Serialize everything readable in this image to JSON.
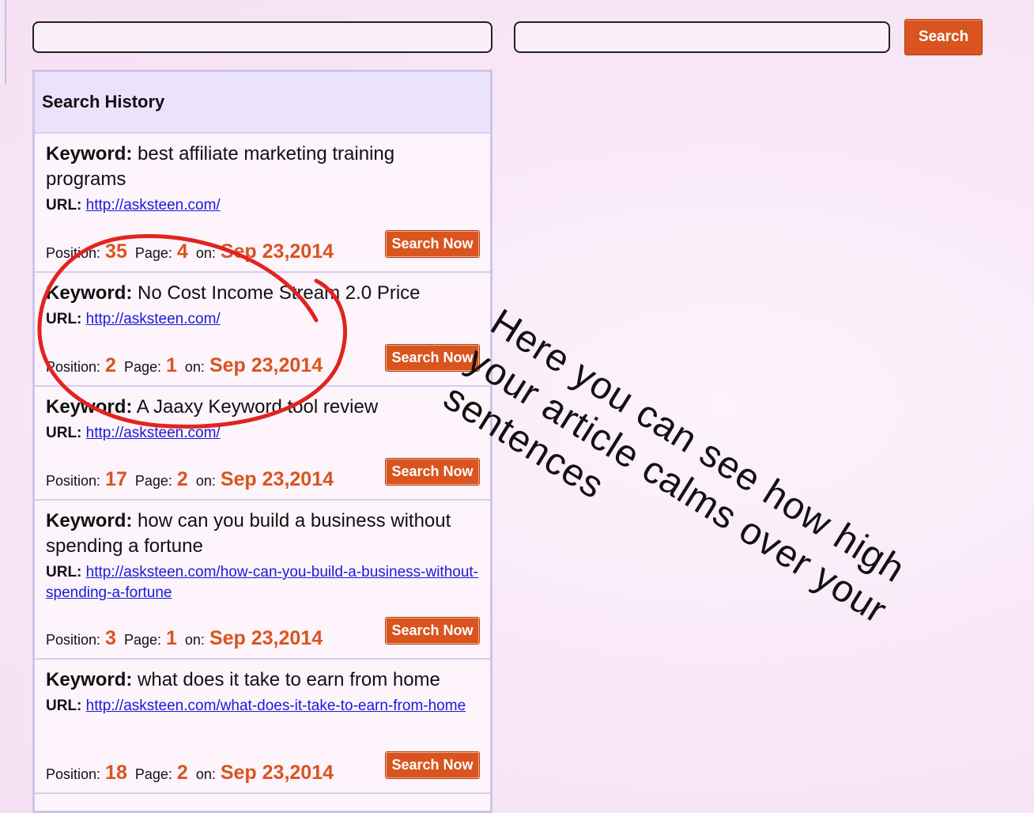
{
  "search": {
    "keyword_value": "",
    "url_value": "",
    "button_label": "Search"
  },
  "history": {
    "title": "Search History",
    "labels": {
      "keyword": "Keyword:",
      "url": "URL:",
      "position": "Position:",
      "page": "Page:",
      "on": "on:",
      "button": "Search Now"
    },
    "entries": [
      {
        "keyword": "best affiliate marketing training programs",
        "url": "http://asksteen.com/",
        "position": "35",
        "page": "4",
        "date": "Sep 23,2014"
      },
      {
        "keyword": "No Cost Income Stream 2.0 Price",
        "url": "http://asksteen.com/",
        "position": "2",
        "page": "1",
        "date": "Sep 23,2014"
      },
      {
        "keyword": "A Jaaxy Keyword tool review",
        "url": "http://asksteen.com/",
        "position": "17",
        "page": "2",
        "date": "Sep 23,2014"
      },
      {
        "keyword": "how can you build a business without spending a fortune",
        "url": "http://asksteen.com/how-can-you-build-a-business-without-spending-a-fortune",
        "position": "3",
        "page": "1",
        "date": "Sep 23,2014"
      },
      {
        "keyword": "what does it take to earn from home",
        "url": "http://asksteen.com/what-does-it-take-to-earn-from-home",
        "position": "18",
        "page": "2",
        "date": "Sep 23,2014"
      }
    ]
  },
  "annotation": {
    "text": "Here you can see how high your article calms over your sentences",
    "circle_color": "#e0241f"
  }
}
